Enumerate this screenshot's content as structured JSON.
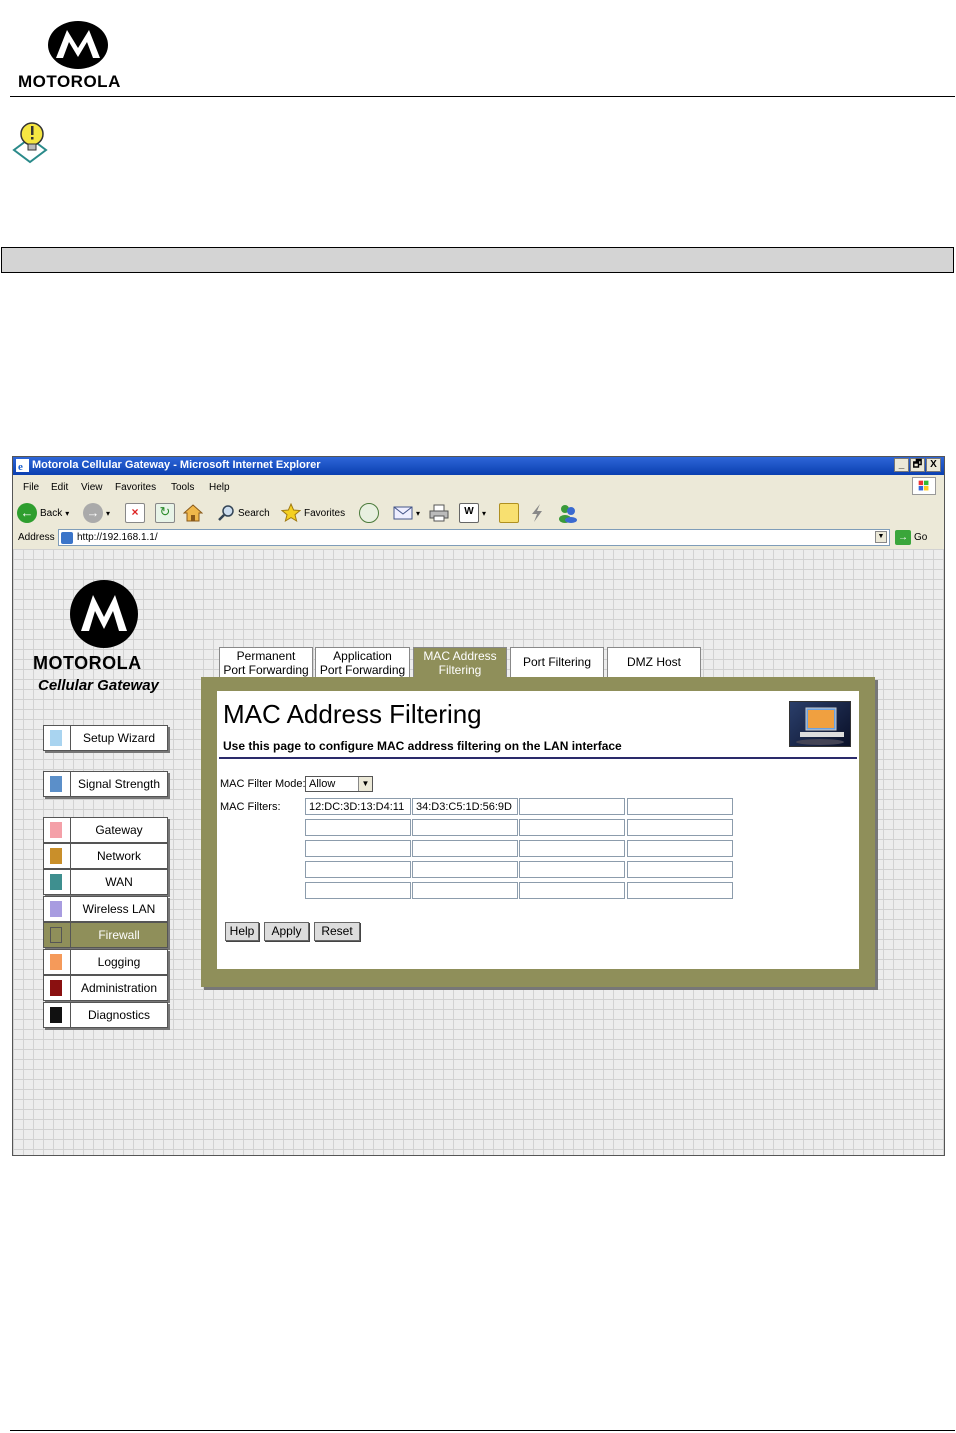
{
  "document": {
    "brand": "MOTOROLA"
  },
  "browser": {
    "title": "Motorola Cellular Gateway - Microsoft Internet Explorer",
    "window_buttons": [
      "_",
      "🗗",
      "X"
    ],
    "menu": [
      "File",
      "Edit",
      "View",
      "Favorites",
      "Tools",
      "Help"
    ],
    "toolbar": {
      "back_label": "Back",
      "search_label": "Search",
      "favorites_label": "Favorites"
    },
    "address": {
      "label": "Address",
      "url": "http://192.168.1.1/",
      "go_label": "Go"
    }
  },
  "gateway": {
    "brand": "MOTOROLA",
    "subtitle": "Cellular Gateway",
    "nav": [
      {
        "label": "Setup Wizard",
        "color": "#a9d4f0"
      },
      {
        "label": "Signal Strength",
        "color": "#5b8fc9"
      },
      {
        "label": "Gateway",
        "color": "#f4a0a8"
      },
      {
        "label": "Network",
        "color": "#c98f2a"
      },
      {
        "label": "WAN",
        "color": "#3e8f8f"
      },
      {
        "label": "Wireless LAN",
        "color": "#a89ce0"
      },
      {
        "label": "Firewall",
        "color": "#8f8f5a"
      },
      {
        "label": "Logging",
        "color": "#f59a5a"
      },
      {
        "label": "Administration",
        "color": "#8a1010"
      },
      {
        "label": "Diagnostics",
        "color": "#111111"
      }
    ],
    "active_nav": "Firewall",
    "tabs": [
      {
        "line1": "Permanent",
        "line2": "Port Forwarding"
      },
      {
        "line1": "Application",
        "line2": "Port Forwarding"
      },
      {
        "line1": "MAC Address",
        "line2": "Filtering"
      },
      {
        "line1": "Port Filtering",
        "line2": ""
      },
      {
        "line1": "DMZ Host",
        "line2": ""
      }
    ],
    "active_tab": "MAC Address Filtering"
  },
  "panel": {
    "title": "MAC Address Filtering",
    "description": "Use this page to configure MAC address filtering on the LAN interface",
    "mode_label": "MAC Filter Mode:",
    "mode_value": "Allow",
    "filters_label": "MAC Filters:",
    "filters": [
      [
        "12:DC:3D:13:D4:11",
        "34:D3:C5:1D:56:9D",
        "",
        ""
      ],
      [
        "",
        "",
        "",
        ""
      ],
      [
        "",
        "",
        "",
        ""
      ],
      [
        "",
        "",
        "",
        ""
      ],
      [
        "",
        "",
        "",
        ""
      ]
    ],
    "buttons": {
      "help": "Help",
      "apply": "Apply",
      "reset": "Reset"
    }
  }
}
